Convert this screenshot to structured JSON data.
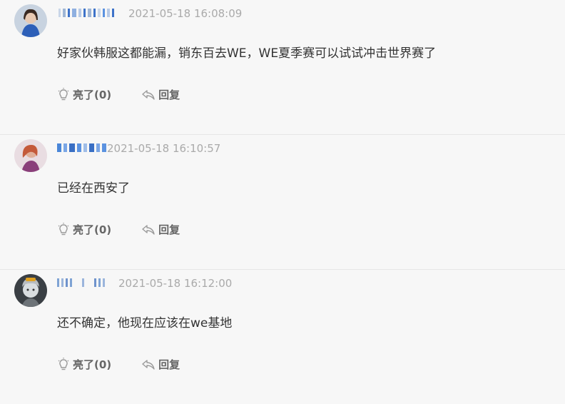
{
  "comments": [
    {
      "username_colors": [
        "#c9d6e8",
        "#9fb6d6",
        "#3e73c9",
        "#8fb0e0",
        "#b6c9e6"
      ],
      "timestamp": "2021-05-18 16:08:09",
      "text": "好家伙韩服这都能漏，销东百去WE，WE夏季赛可以试试冲击世界赛了",
      "like_label": "亮了(0)",
      "reply_label": "回复",
      "avatar_icon": "user-avatar-icon"
    },
    {
      "username_colors": [
        "#4a86d8",
        "#3a6fc4",
        "#5b92e0"
      ],
      "timestamp": "2021-05-18 16:10:57",
      "text": "已经在西安了",
      "like_label": "亮了(0)",
      "reply_label": "回复",
      "avatar_icon": "user-avatar-icon"
    },
    {
      "username_colors": [
        "#7fa3d4",
        "#9bb5dc",
        "#6f93cc"
      ],
      "timestamp": "2021-05-18 16:12:00",
      "text": "还不确定，他现在应该在we基地",
      "like_label": "亮了(0)",
      "reply_label": "回复",
      "avatar_icon": "user-avatar-icon"
    }
  ]
}
